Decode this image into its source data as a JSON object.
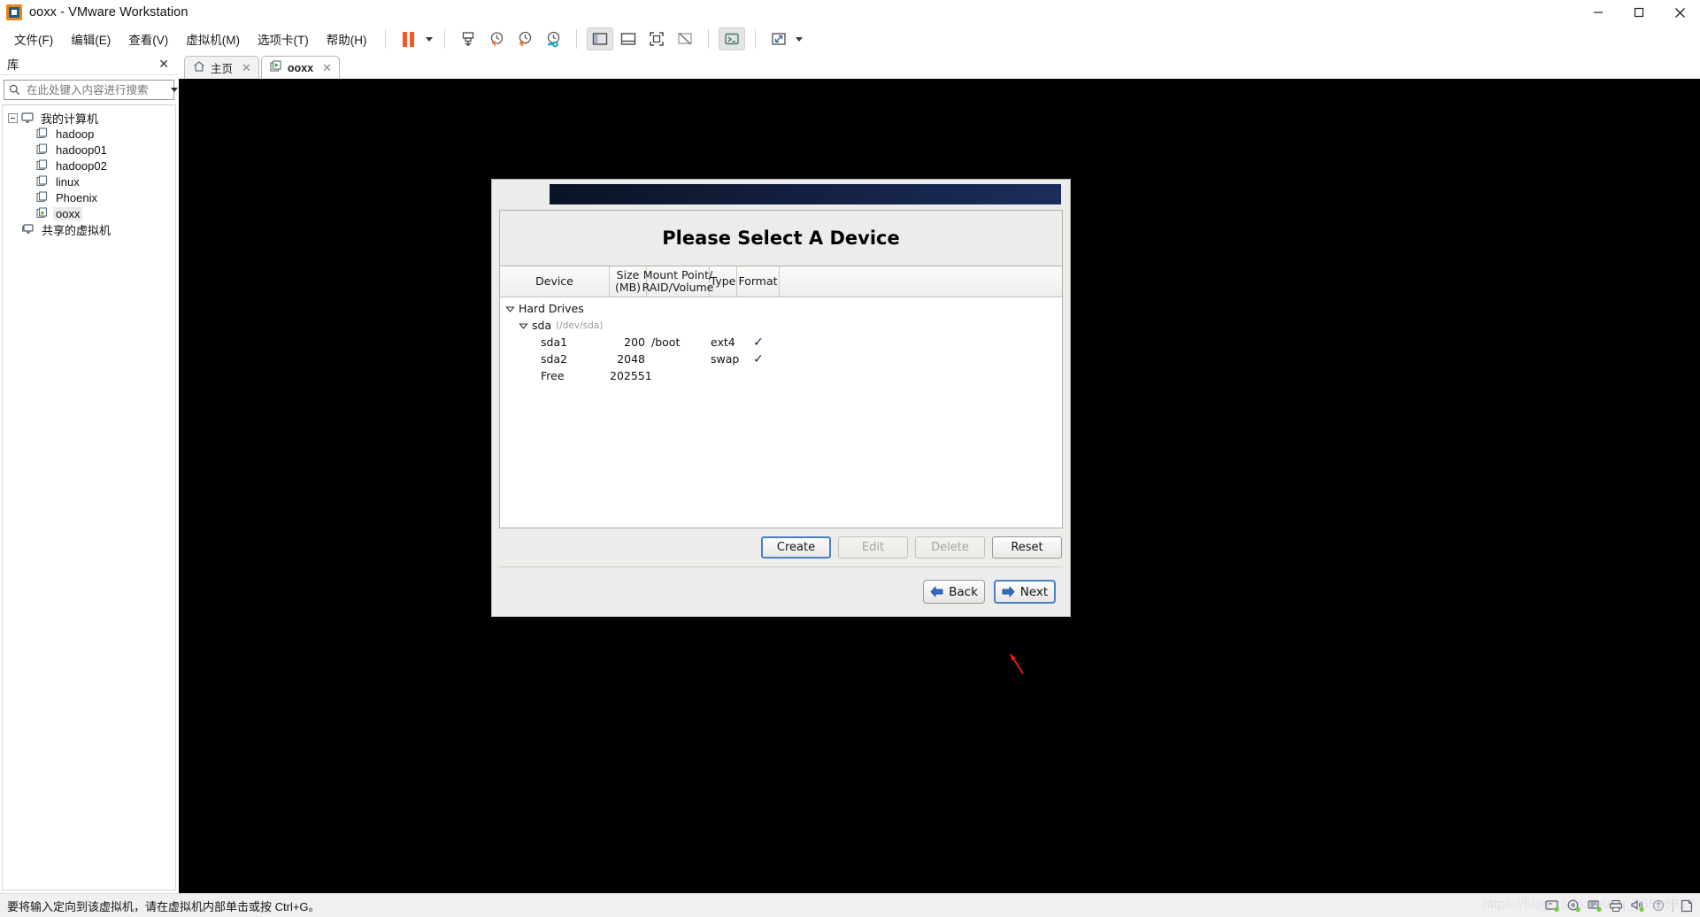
{
  "window": {
    "title": "ooxx - VMware Workstation",
    "app_icon": "vmware-logo-icon",
    "minimize_label": "minimize",
    "maximize_label": "maximize",
    "close_label": "close"
  },
  "menubar": {
    "items": [
      {
        "label": "文件(F)",
        "name": "menu-file"
      },
      {
        "label": "编辑(E)",
        "name": "menu-edit"
      },
      {
        "label": "查看(V)",
        "name": "menu-view"
      },
      {
        "label": "虚拟机(M)",
        "name": "menu-vm"
      },
      {
        "label": "选项卡(T)",
        "name": "menu-tabs"
      },
      {
        "label": "帮助(H)",
        "name": "menu-help"
      }
    ],
    "toolbar": [
      {
        "name": "pause-button",
        "icon": "pause-icon"
      },
      {
        "name": "pause-dropdown",
        "icon": "chevron-down-icon"
      },
      {
        "name": "snapshot-button",
        "icon": "snapshot-save-icon"
      },
      {
        "name": "take-snapshot-button",
        "icon": "clock-plus-icon"
      },
      {
        "name": "revert-snapshot-button",
        "icon": "clock-back-icon"
      },
      {
        "name": "snapshot-manager-button",
        "icon": "clock-wrench-icon"
      },
      {
        "name": "show-library-button",
        "icon": "panel-left-icon"
      },
      {
        "name": "show-thumbnails-button",
        "icon": "panel-bottom-icon"
      },
      {
        "name": "fullscreen-button",
        "icon": "expand-frame-icon"
      },
      {
        "name": "unity-button",
        "icon": "unity-icon"
      },
      {
        "name": "console-button",
        "icon": "terminal-icon"
      },
      {
        "name": "stretch-button",
        "icon": "arrows-diagonal-icon"
      },
      {
        "name": "stretch-dropdown",
        "icon": "chevron-down-icon"
      }
    ]
  },
  "sidebar": {
    "header": "库",
    "close_icon": "close-icon",
    "search": {
      "placeholder": "在此处键入内容进行搜索",
      "value": "",
      "icon": "search-icon",
      "dropdown_icon": "chevron-down-icon"
    },
    "tree": [
      {
        "label": "我的计算机",
        "icon": "computer-icon",
        "indent": 0,
        "expander": true,
        "selected": false
      },
      {
        "label": "hadoop",
        "icon": "vm-icon",
        "indent": 1,
        "expander": false,
        "selected": false
      },
      {
        "label": "hadoop01",
        "icon": "vm-icon",
        "indent": 1,
        "expander": false,
        "selected": false
      },
      {
        "label": "hadoop02",
        "icon": "vm-icon",
        "indent": 1,
        "expander": false,
        "selected": false
      },
      {
        "label": "linux",
        "icon": "vm-icon",
        "indent": 1,
        "expander": false,
        "selected": false
      },
      {
        "label": "Phoenix",
        "icon": "vm-icon",
        "indent": 1,
        "expander": false,
        "selected": false
      },
      {
        "label": "ooxx",
        "icon": "vm-running-icon",
        "indent": 1,
        "expander": false,
        "selected": true
      },
      {
        "label": "共享的虚拟机",
        "icon": "shared-vms-icon",
        "indent": 0,
        "expander": false,
        "selected": false
      }
    ]
  },
  "tabs": [
    {
      "label": "主页",
      "icon": "home-icon",
      "active": false,
      "close_icon": "close-icon"
    },
    {
      "label": "ooxx",
      "icon": "vm-running-icon",
      "active": true,
      "close_icon": "close-icon"
    }
  ],
  "dialog": {
    "title": "Please Select A Device",
    "table": {
      "headers": [
        {
          "line1": "Device",
          "line2": ""
        },
        {
          "line1": "Size",
          "line2": "(MB)"
        },
        {
          "line1": "Mount Point/",
          "line2": "RAID/Volume"
        },
        {
          "line1": "Type",
          "line2": ""
        },
        {
          "line1": "Format",
          "line2": ""
        }
      ],
      "rows": [
        {
          "device": "Hard Drives",
          "detail": "",
          "size": "",
          "mount": "",
          "type": "",
          "format": "",
          "indent": 0,
          "twisty": true
        },
        {
          "device": "sda",
          "detail": "(/dev/sda)",
          "size": "",
          "mount": "",
          "type": "",
          "format": "",
          "indent": 1,
          "twisty": true
        },
        {
          "device": "sda1",
          "detail": "",
          "size": "200",
          "mount": "/boot",
          "type": "ext4",
          "format": "✓",
          "indent": 2,
          "twisty": false
        },
        {
          "device": "sda2",
          "detail": "",
          "size": "2048",
          "mount": "",
          "type": "swap",
          "format": "✓",
          "indent": 2,
          "twisty": false
        },
        {
          "device": "Free",
          "detail": "",
          "size": "202551",
          "mount": "",
          "type": "",
          "format": "",
          "indent": 2,
          "twisty": false
        }
      ]
    },
    "buttons": [
      {
        "label": "Create",
        "state": "focused",
        "name": "create-button"
      },
      {
        "label": "Edit",
        "state": "disabled",
        "name": "edit-button"
      },
      {
        "label": "Delete",
        "state": "disabled",
        "name": "delete-button"
      },
      {
        "label": "Reset",
        "state": "enabled",
        "name": "reset-button"
      }
    ],
    "nav": {
      "back_label": "Back",
      "next_label": "Next",
      "back_icon": "arrow-left-icon",
      "next_icon": "arrow-right-icon"
    },
    "annotation": {
      "type": "red-arrow",
      "color": "#e81b1b",
      "points_to": "create-button"
    }
  },
  "statusbar": {
    "message": "要将输入定向到该虚拟机，请在虚拟机内部单击或按 Ctrl+G。",
    "watermark": "https://blog.csdn.net/qq_36596317",
    "icons": [
      {
        "name": "hard-disk-status-icon"
      },
      {
        "name": "cd-dvd-status-icon"
      },
      {
        "name": "network-status-icon"
      },
      {
        "name": "printer-status-icon"
      },
      {
        "name": "sound-status-icon"
      },
      {
        "name": "usb-status-icon"
      },
      {
        "name": "message-log-status-icon"
      }
    ]
  },
  "colors": {
    "accent_orange": "#ef5a28",
    "banner_navy": "#16254c",
    "focus_blue": "#4b7fc4",
    "annotation_red": "#e81b1b",
    "console_black": "#000000"
  }
}
